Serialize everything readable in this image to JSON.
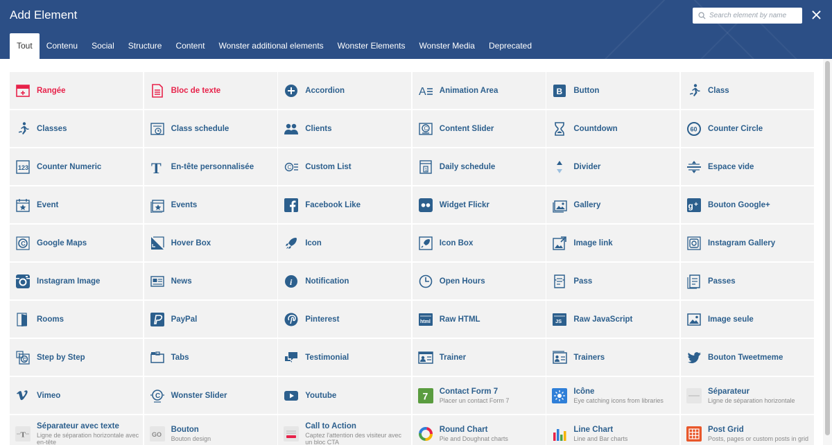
{
  "header": {
    "title": "Add Element",
    "search_placeholder": "Search element by name",
    "search_value": "",
    "bg_color": "#2c4f86"
  },
  "tabs": [
    {
      "label": "Tout",
      "active": true
    },
    {
      "label": "Contenu"
    },
    {
      "label": "Social"
    },
    {
      "label": "Structure"
    },
    {
      "label": "Content"
    },
    {
      "label": "Wonster additional elements"
    },
    {
      "label": "Wonster Elements"
    },
    {
      "label": "Wonster Media"
    },
    {
      "label": "Deprecated"
    }
  ],
  "colors": {
    "label": "#2c5f8d",
    "label_highlight": "#e7224a",
    "icon": "#2c5f8d",
    "cell_bg": "#f2f2f2"
  },
  "elements": [
    {
      "label": "Rangée",
      "icon": "row-icon",
      "highlight": true
    },
    {
      "label": "Bloc de texte",
      "icon": "text-block-icon",
      "highlight": true
    },
    {
      "label": "Accordion",
      "icon": "accordion-icon"
    },
    {
      "label": "Animation Area",
      "icon": "animation-area-icon"
    },
    {
      "label": "Button",
      "icon": "button-icon"
    },
    {
      "label": "Class",
      "icon": "runner-icon"
    },
    {
      "label": "Classes",
      "icon": "runner-icon"
    },
    {
      "label": "Class schedule",
      "icon": "schedule-icon"
    },
    {
      "label": "Clients",
      "icon": "users-icon"
    },
    {
      "label": "Content Slider",
      "icon": "content-slider-icon"
    },
    {
      "label": "Countdown",
      "icon": "hourglass-icon"
    },
    {
      "label": "Counter Circle",
      "icon": "counter-circle-icon"
    },
    {
      "label": "Counter Numeric",
      "icon": "counter-numeric-icon"
    },
    {
      "label": "En-tête personnalisée",
      "icon": "custom-heading-icon"
    },
    {
      "label": "Custom List",
      "icon": "custom-list-icon"
    },
    {
      "label": "Daily schedule",
      "icon": "daily-schedule-icon"
    },
    {
      "label": "Divider",
      "icon": "divider-icon"
    },
    {
      "label": "Espace vide",
      "icon": "empty-space-icon"
    },
    {
      "label": "Event",
      "icon": "event-icon"
    },
    {
      "label": "Events",
      "icon": "events-icon"
    },
    {
      "label": "Facebook Like",
      "icon": "facebook-icon"
    },
    {
      "label": "Widget Flickr",
      "icon": "flickr-icon"
    },
    {
      "label": "Gallery",
      "icon": "gallery-icon"
    },
    {
      "label": "Bouton Google+",
      "icon": "google-plus-icon"
    },
    {
      "label": "Google Maps",
      "icon": "google-maps-icon"
    },
    {
      "label": "Hover Box",
      "icon": "hover-box-icon"
    },
    {
      "label": "Icon",
      "icon": "rocket-icon"
    },
    {
      "label": "Icon Box",
      "icon": "icon-box-icon"
    },
    {
      "label": "Image link",
      "icon": "image-link-icon"
    },
    {
      "label": "Instagram Gallery",
      "icon": "instagram-gallery-icon"
    },
    {
      "label": "Instagram Image",
      "icon": "instagram-icon"
    },
    {
      "label": "News",
      "icon": "news-icon"
    },
    {
      "label": "Notification",
      "icon": "info-icon"
    },
    {
      "label": "Open Hours",
      "icon": "clock-icon"
    },
    {
      "label": "Pass",
      "icon": "pass-icon"
    },
    {
      "label": "Passes",
      "icon": "passes-icon"
    },
    {
      "label": "Rooms",
      "icon": "door-icon"
    },
    {
      "label": "PayPal",
      "icon": "paypal-icon"
    },
    {
      "label": "Pinterest",
      "icon": "pinterest-icon"
    },
    {
      "label": "Raw HTML",
      "icon": "raw-html-icon"
    },
    {
      "label": "Raw JavaScript",
      "icon": "raw-js-icon"
    },
    {
      "label": "Image seule",
      "icon": "single-image-icon"
    },
    {
      "label": "Step by Step",
      "icon": "step-by-step-icon"
    },
    {
      "label": "Tabs",
      "icon": "tabs-icon"
    },
    {
      "label": "Testimonial",
      "icon": "testimonial-icon"
    },
    {
      "label": "Trainer",
      "icon": "trainer-icon"
    },
    {
      "label": "Trainers",
      "icon": "trainers-icon"
    },
    {
      "label": "Bouton Tweetmeme",
      "icon": "twitter-icon"
    },
    {
      "label": "Vimeo",
      "icon": "vimeo-icon"
    },
    {
      "label": "Wonster Slider",
      "icon": "wonster-slider-icon"
    },
    {
      "label": "Youtube",
      "icon": "youtube-icon"
    },
    {
      "label": "Contact Form 7",
      "icon": "contact-form-icon",
      "desc": "Placer un contact Form 7"
    },
    {
      "label": "Icône",
      "icon": "icon-library-icon",
      "desc": "Eye catching icons from libraries"
    },
    {
      "label": "Séparateur",
      "icon": "separator-icon",
      "desc": "Ligne de séparation horizontale"
    },
    {
      "label": "Séparateur avec texte",
      "icon": "separator-text-icon",
      "desc": "Ligne de séparation horizontale avec en-tête"
    },
    {
      "label": "Bouton",
      "icon": "go-button-icon",
      "desc": "Bouton design"
    },
    {
      "label": "Call to Action",
      "icon": "call-to-action-icon",
      "desc": "Captez l'attention des visiteur avec un bloc CTA"
    },
    {
      "label": "Round Chart",
      "icon": "round-chart-icon",
      "desc": "Pie and Doughnat charts"
    },
    {
      "label": "Line Chart",
      "icon": "line-chart-icon",
      "desc": "Line and Bar charts"
    },
    {
      "label": "Post Grid",
      "icon": "post-grid-icon",
      "desc": "Posts, pages or custom posts in grid"
    }
  ]
}
